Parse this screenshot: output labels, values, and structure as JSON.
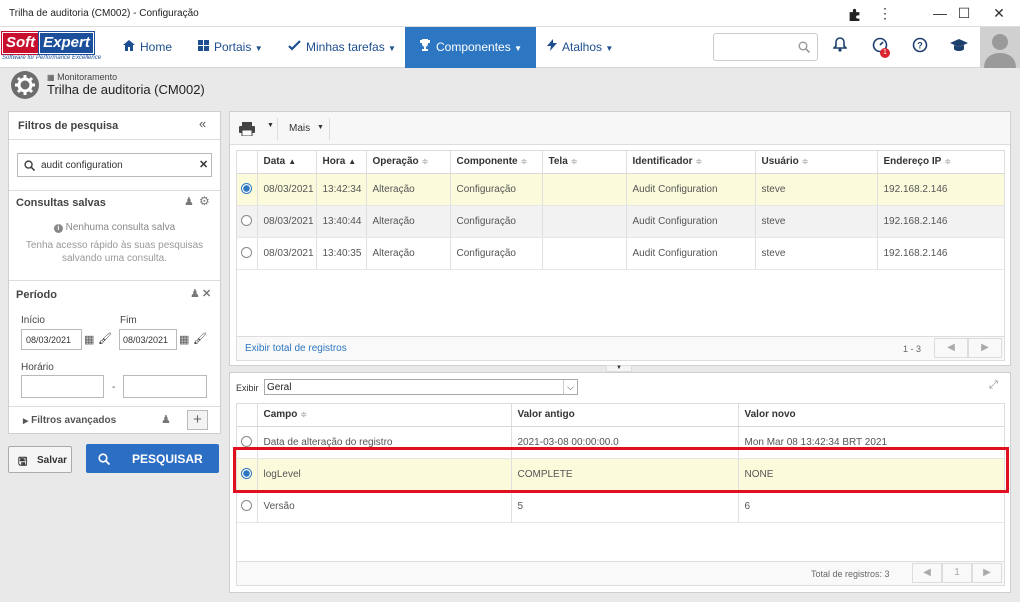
{
  "window": {
    "title": "Trilha de auditoria (CM002) - Configuração"
  },
  "nav": {
    "logo_text_1": "Soft",
    "logo_text_2": "Expert",
    "logo_tagline": "Software for Performance Excellence",
    "items": [
      {
        "label": "Home",
        "icon": "home-icon"
      },
      {
        "label": "Portais",
        "icon": "grid-icon"
      },
      {
        "label": "Minhas tarefas",
        "icon": "check-icon"
      },
      {
        "label": "Componentes",
        "icon": "trophy-icon"
      },
      {
        "label": "Atalhos",
        "icon": "bolt-icon"
      }
    ],
    "notification_badge": "1"
  },
  "header": {
    "breadcrumb": "Monitoramento",
    "title": "Trilha de auditoria (CM002)"
  },
  "filters": {
    "title": "Filtros de pesquisa",
    "search_value": "audit configuration",
    "saved_title": "Consultas salvas",
    "saved_empty": "Nenhuma consulta salva",
    "saved_hint": "Tenha acesso rápido às suas pesquisas salvando uma consulta.",
    "period_title": "Período",
    "start_label": "Início",
    "start_value": "08/03/2021",
    "end_label": "Fim",
    "end_value": "08/03/2021",
    "time_label": "Horário",
    "time_separator": "-",
    "advanced": "Filtros avançados",
    "save_button": "Salvar",
    "search_button": "PESQUISAR"
  },
  "toolbar": {
    "more": "Mais"
  },
  "audit_table": {
    "columns": [
      "Data",
      "Hora",
      "Operação",
      "Componente",
      "Tela",
      "Identificador",
      "Usuário",
      "Endereço IP"
    ],
    "rows": [
      {
        "selected": true,
        "cells": [
          "08/03/2021",
          "13:42:34",
          "Alteração",
          "Configuração",
          "",
          "Audit Configuration",
          "steve",
          "192.168.2.146"
        ]
      },
      {
        "selected": false,
        "cells": [
          "08/03/2021",
          "13:40:44",
          "Alteração",
          "Configuração",
          "",
          "Audit Configuration",
          "steve",
          "192.168.2.146"
        ]
      },
      {
        "selected": false,
        "cells": [
          "08/03/2021",
          "13:40:35",
          "Alteração",
          "Configuração",
          "",
          "Audit Configuration",
          "steve",
          "192.168.2.146"
        ]
      }
    ],
    "show_total": "Exibir total de registros",
    "page_range": "1 - 3"
  },
  "detail": {
    "show_label": "Exibir",
    "show_value": "Geral",
    "columns": [
      "Campo",
      "Valor antigo",
      "Valor novo"
    ],
    "rows": [
      {
        "selected": false,
        "cells": [
          "Data de alteração do registro",
          "2021-03-08 00:00:00.0",
          "Mon Mar 08 13:42:34 BRT 2021"
        ]
      },
      {
        "selected": true,
        "cells": [
          "logLevel",
          "COMPLETE",
          "NONE"
        ]
      },
      {
        "selected": false,
        "cells": [
          "Versão",
          "5",
          "6"
        ]
      }
    ],
    "total": "Total de registros: 3",
    "page": "1"
  },
  "colors": {
    "accent": "#2d77c2",
    "highlight_row": "#fbfbdc",
    "annotation_red": "#e01020"
  }
}
